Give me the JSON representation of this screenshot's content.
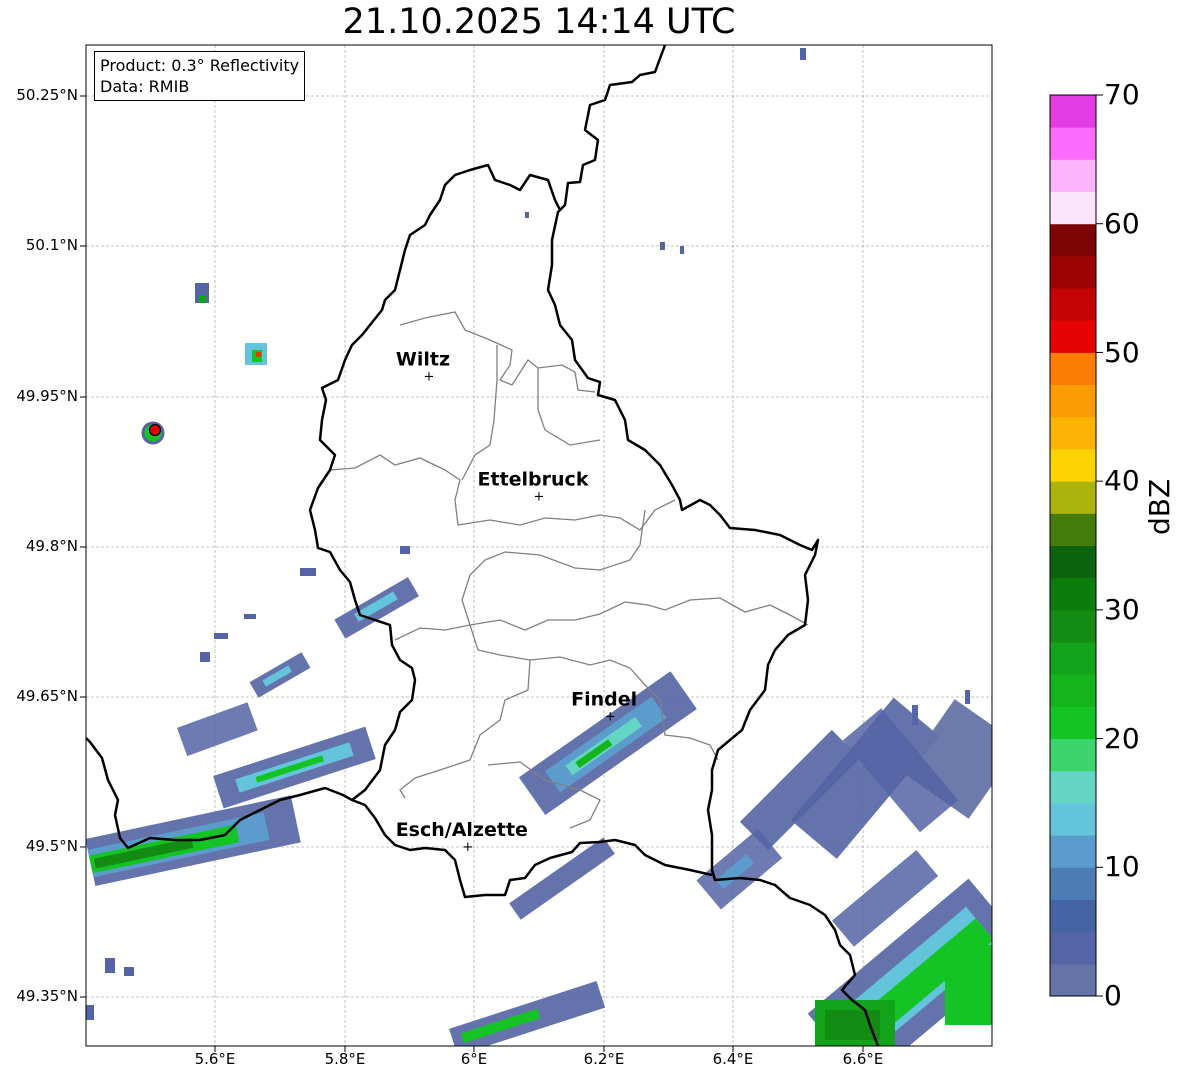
{
  "title": "21.10.2025 14:14 UTC",
  "info_box": {
    "product": "Product: 0.3° Reflectivity",
    "data": "Data: RMIB"
  },
  "axes": {
    "lat_ticks": [
      "50.25°N",
      "50.1°N",
      "49.95°N",
      "49.8°N",
      "49.65°N",
      "49.5°N",
      "49.35°N"
    ],
    "lon_ticks": [
      "5.6°E",
      "5.8°E",
      "6°E",
      "6.2°E",
      "6.4°E",
      "6.6°E"
    ],
    "lat_range": [
      49.3,
      50.3
    ],
    "lon_range": [
      5.4,
      6.8
    ],
    "grid": true
  },
  "cities": [
    {
      "name": "Wiltz",
      "lon": 5.93,
      "lat": 49.97
    },
    {
      "name": "Ettelbruck",
      "lon": 6.1,
      "lat": 49.85
    },
    {
      "name": "Findel",
      "lon": 6.21,
      "lat": 49.63
    },
    {
      "name": "Esch/Alzette",
      "lon": 5.99,
      "lat": 49.5
    }
  ],
  "colorbar": {
    "label": "dBZ",
    "range": [
      0,
      70
    ],
    "ticks": [
      "0",
      "10",
      "20",
      "30",
      "40",
      "50",
      "60",
      "70"
    ],
    "colors": [
      "#6474a8",
      "#5464a4",
      "#4464a4",
      "#4c7cb4",
      "#5c9ccc",
      "#64c4dc",
      "#64d4c4",
      "#3cd46c",
      "#14c424",
      "#14b41c",
      "#14a41c",
      "#148c14",
      "#0c7c0c",
      "#0c640c",
      "#447c0c",
      "#acb40c",
      "#fcd404",
      "#fcb404",
      "#fc9c04",
      "#fc7c04",
      "#e40404",
      "#c40404",
      "#9c0404",
      "#7c0404",
      "#fce4fc",
      "#fcb4fc",
      "#fc6cfc",
      "#e43ce4"
    ]
  },
  "radar_site_color": "#e00000"
}
